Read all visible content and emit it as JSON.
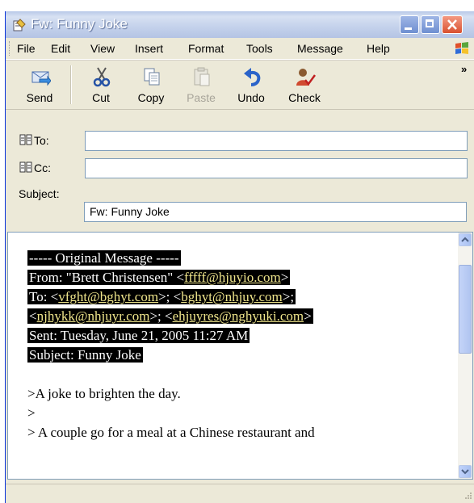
{
  "window": {
    "title": "Fw: Funny Joke"
  },
  "menu": {
    "items": [
      {
        "label": "File"
      },
      {
        "label": "Edit"
      },
      {
        "label": "View"
      },
      {
        "label": "Insert"
      },
      {
        "label": "Format"
      },
      {
        "label": "Tools"
      },
      {
        "label": "Message"
      },
      {
        "label": "Help"
      }
    ]
  },
  "toolbar": {
    "buttons": [
      {
        "label": "Send",
        "icon": "send-icon"
      },
      {
        "label": "Cut",
        "icon": "scissors-icon"
      },
      {
        "label": "Copy",
        "icon": "copy-icon"
      },
      {
        "label": "Paste",
        "icon": "paste-icon",
        "enabled": false
      },
      {
        "label": "Undo",
        "icon": "undo-icon"
      },
      {
        "label": "Check",
        "icon": "check-names-icon"
      }
    ],
    "overflow": "»"
  },
  "header": {
    "to": {
      "label": "To:",
      "value": ""
    },
    "cc": {
      "label": "Cc:",
      "value": ""
    },
    "subject": {
      "label": "Subject:",
      "value": "Fw: Funny Joke"
    }
  },
  "message": {
    "original_header": "----- Original Message -----",
    "from_prefix": "From: \"Brett Christensen\" <",
    "from_email": "fffff@hjuyio.com",
    "to_prefix": "To: <",
    "to_emails": [
      "vfght@bghyt.com",
      "bghyt@nhjuy.com",
      "njhykk@nhjuyr.com",
      "ehjuyres@nghyuki.com"
    ],
    "sent": "Sent: Tuesday, June 21, 2005 11:27 AM",
    "subject": "Subject: Funny Joke",
    "body_lines": [
      ">A joke to brighten the day.",
      ">",
      "> A couple go for a meal at a Chinese restaurant and"
    ]
  }
}
